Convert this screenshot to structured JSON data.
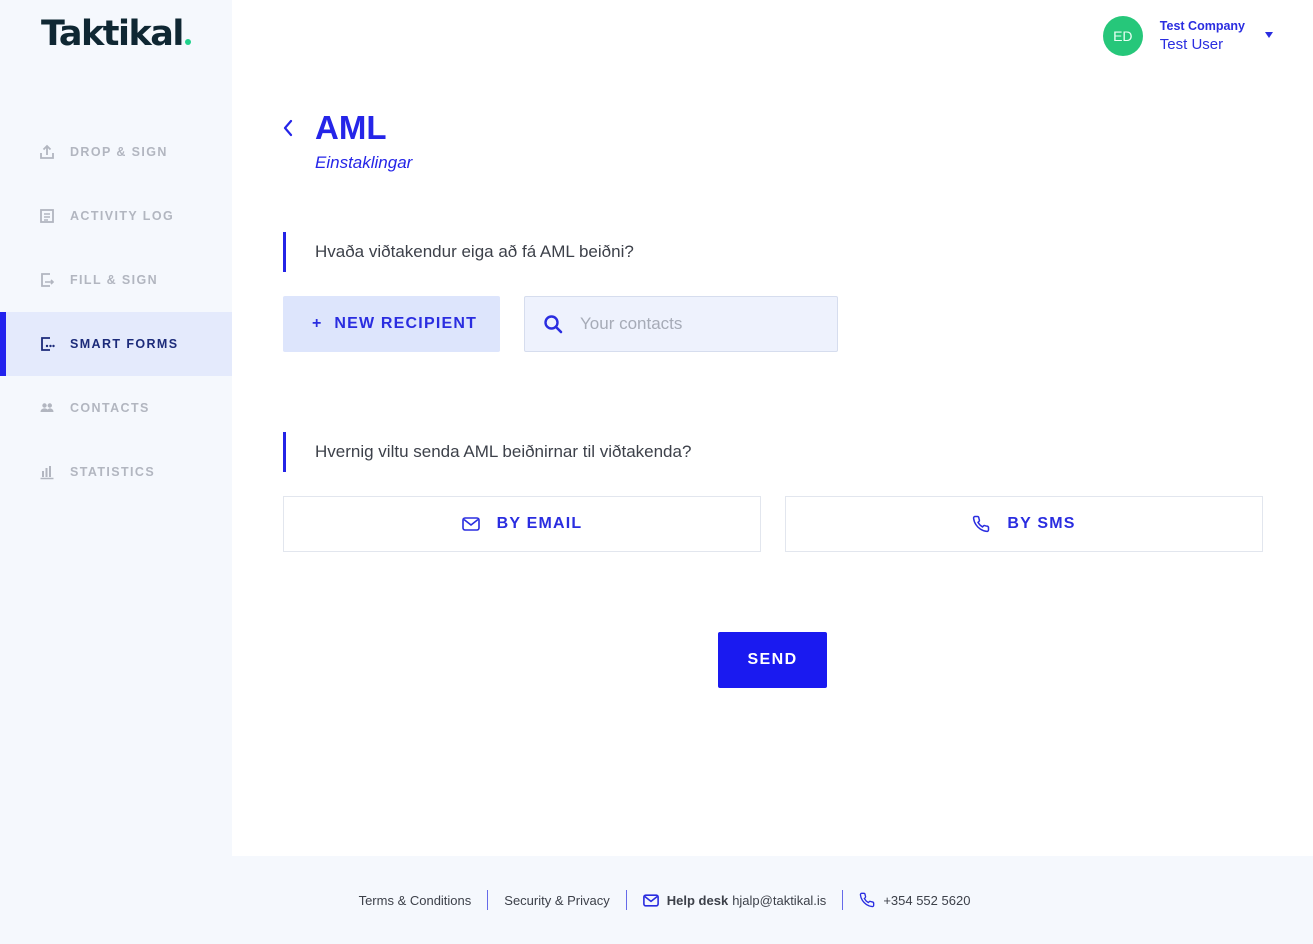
{
  "brand": {
    "logo_text": "Taktikal",
    "accent": "#1fd18b"
  },
  "sidebar": {
    "items": [
      {
        "label": "DROP & SIGN",
        "icon": "upload-icon"
      },
      {
        "label": "ACTIVITY LOG",
        "icon": "log-icon"
      },
      {
        "label": "FILL & SIGN",
        "icon": "fill-sign-icon"
      },
      {
        "label": "SMART FORMS",
        "icon": "smart-forms-icon",
        "active": true
      },
      {
        "label": "CONTACTS",
        "icon": "contacts-icon"
      },
      {
        "label": "STATISTICS",
        "icon": "statistics-icon"
      }
    ]
  },
  "header": {
    "avatar_initials": "ED",
    "company": "Test Company",
    "user_name": "Test User"
  },
  "page": {
    "title": "AML",
    "subtitle": "Einstaklingar",
    "question_recipients": "Hvaða viðtakendur eiga að fá AML beiðni?",
    "new_recipient_label": "NEW RECIPIENT",
    "contacts_placeholder": "Your contacts",
    "question_method": "Hvernig viltu senda AML beiðnirnar til viðtakenda?",
    "by_email_label": "BY EMAIL",
    "by_sms_label": "BY SMS",
    "send_label": "SEND"
  },
  "footer": {
    "terms": "Terms & Conditions",
    "security": "Security & Privacy",
    "helpdesk_label": "Help desk",
    "helpdesk_email": "hjalp@taktikal.is",
    "phone": "+354 552 5620"
  },
  "colors": {
    "primary": "#1a1af0",
    "avatar": "#26c77a",
    "active_nav_bg": "#e4eafc"
  }
}
